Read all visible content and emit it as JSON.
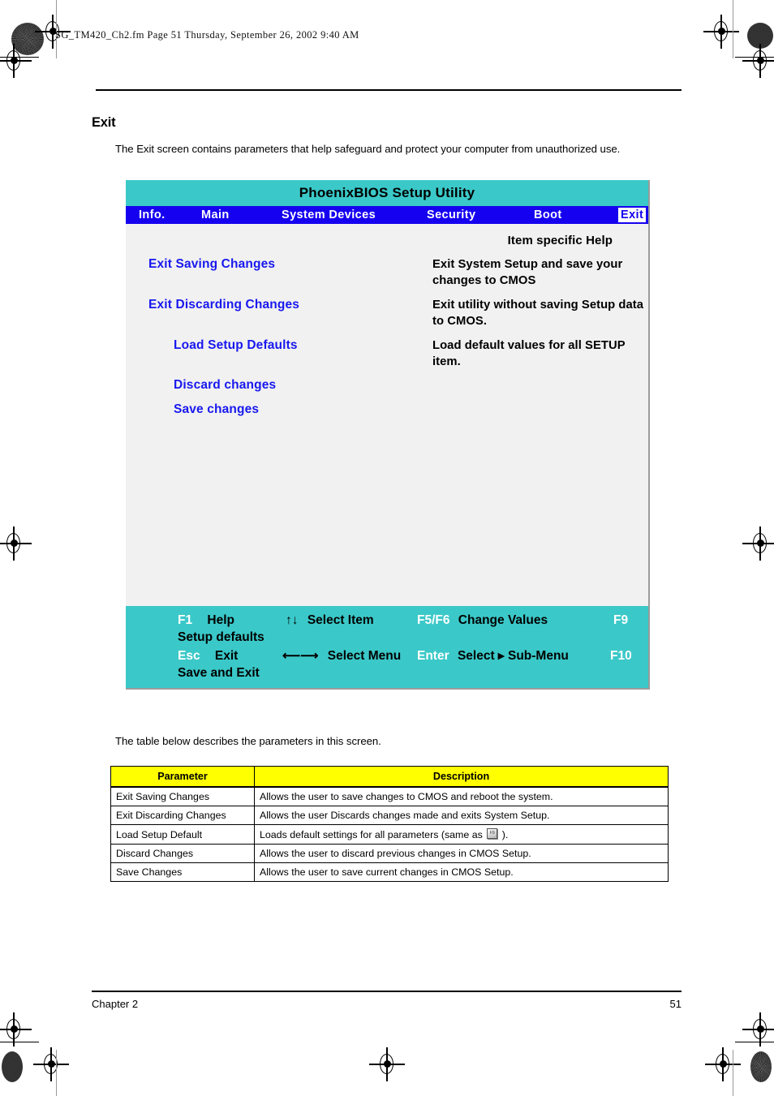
{
  "page": {
    "header_line": "SG_TM420_Ch2.fm  Page 51  Thursday, September 26, 2002  9:40 AM",
    "section_title": "Exit",
    "section_intro": "The Exit screen contains parameters that help safeguard and protect your computer from unauthorized use.",
    "table_intro": "The table below describes the parameters in this screen.",
    "footer_chapter": "Chapter 2",
    "footer_pageno": "51"
  },
  "colors": {
    "bios_title_bar": "#3bc8c8",
    "bios_menu_bar": "#1500ef",
    "bios_body": "#f1f1f1",
    "bios_menu_entry": "#1818ef",
    "table_header": "#ffff00"
  },
  "bios": {
    "title": "PhoenixBIOS Setup Utility",
    "menu": [
      {
        "label": "Info.",
        "selected": false
      },
      {
        "label": "Main",
        "selected": false
      },
      {
        "label": "System Devices",
        "selected": false
      },
      {
        "label": "Security",
        "selected": false
      },
      {
        "label": "Boot",
        "selected": false
      },
      {
        "label": "Exit",
        "selected": true
      }
    ],
    "help_panel_title": "Item specific Help",
    "entries": [
      {
        "label": "Exit Saving Changes",
        "help": "Exit System Setup and save your changes to CMOS"
      },
      {
        "label": "Exit Discarding Changes",
        "help": "Exit utility without saving Setup data to CMOS."
      },
      {
        "label": "Load Setup Defaults",
        "help": "Load default values for all SETUP item."
      },
      {
        "label": "Discard changes",
        "help": ""
      },
      {
        "label": "Save changes",
        "help": ""
      }
    ],
    "footer": {
      "row1": [
        {
          "key": "F1",
          "action": "Help"
        },
        {
          "key": "↑↓",
          "action": "Select Item"
        },
        {
          "key": "F5/F6",
          "action": "Change Values"
        },
        {
          "key": "F9",
          "action": "Setup defaults"
        }
      ],
      "row2": [
        {
          "key": "Esc",
          "action": "Exit"
        },
        {
          "key": "⟵⟶",
          "action": "Select Menu"
        },
        {
          "key": "Enter",
          "action": "Select ▸ Sub-Menu"
        },
        {
          "key": "F10",
          "action": "Save and Exit"
        }
      ]
    }
  },
  "table": {
    "headers": [
      "Parameter",
      "Description"
    ],
    "rows": [
      {
        "parameter": "Exit Saving Changes",
        "description": "Allows the user to save changes to CMOS and reboot the system."
      },
      {
        "parameter": "Exit Discarding Changes",
        "description": "Allows the user Discards changes made and exits System Setup."
      },
      {
        "parameter": "Load Setup Default",
        "description_pre": "Loads default settings for all parameters (same as ",
        "icon": "f9-key-icon",
        "description_post": " )."
      },
      {
        "parameter": "Discard Changes",
        "description": "Allows the user to discard previous changes in CMOS Setup."
      },
      {
        "parameter": "Save Changes",
        "description": "Allows the user to save current changes in CMOS Setup."
      }
    ]
  }
}
